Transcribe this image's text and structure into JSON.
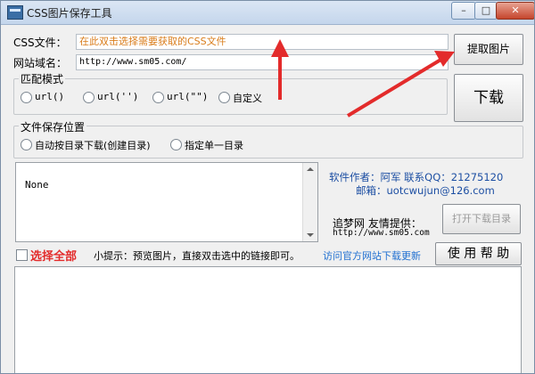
{
  "window": {
    "title": "CSS图片保存工具",
    "min_label": "–",
    "max_label": "□",
    "close_label": "✕"
  },
  "form": {
    "css_label": "CSS文件：",
    "css_placeholder": "在此双击选择需要获取的CSS文件",
    "domain_label": "网站域名：",
    "domain_value": "http://www.sm05.com/"
  },
  "buttons": {
    "extract": "提取图片",
    "download": "下载",
    "open_folder": "打开下载目录",
    "help": "使 用 帮 助"
  },
  "match_mode": {
    "title": "匹配模式",
    "options": [
      "url()",
      "url('')",
      "url(\"\")",
      "自定义"
    ]
  },
  "save_location": {
    "title": "文件保存位置",
    "options": [
      "自动按目录下载(创建目录)",
      "指定单一目录"
    ]
  },
  "list": {
    "text": "None"
  },
  "info": {
    "author": "软件作者：阿军 联系QQ：21275120",
    "email": "邮箱：uotcwujun@126.com",
    "sponsor_label": "追梦网 友情提供：",
    "sponsor_url": "http://www.sm05.com"
  },
  "controls": {
    "select_all": "选择全部",
    "tip": "小提示：预览图片，直接双击选中的链接即可。",
    "visit_link": "访问官方网站下载更新"
  },
  "colors": {
    "accent_red": "#e32b2b",
    "link_blue": "#1d4fa3",
    "placeholder_orange": "#d97c1a"
  }
}
